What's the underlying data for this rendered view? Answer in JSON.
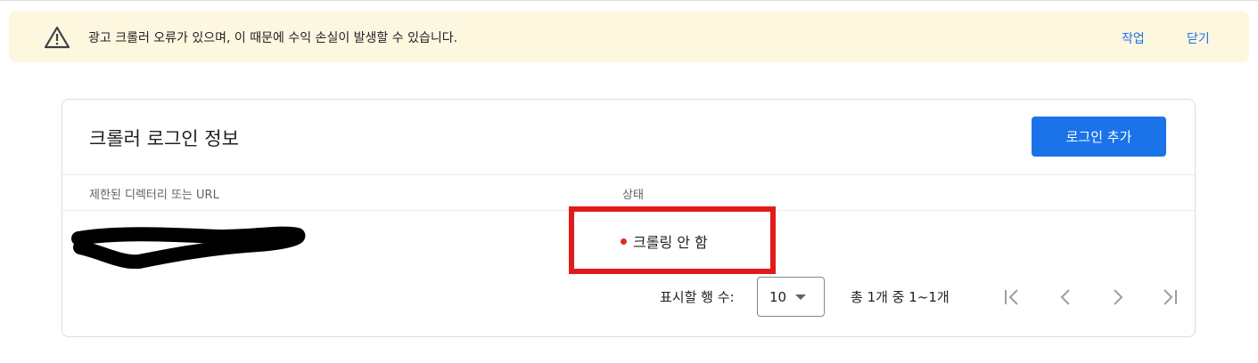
{
  "banner": {
    "icon": "warning-icon",
    "message": "광고 크롤러 오류가 있으며, 이 때문에 수익 손실이 발생할 수 있습니다.",
    "action_label": "작업",
    "close_label": "닫기",
    "background": "#fef7e0",
    "link_color": "#1a73e8"
  },
  "card": {
    "title": "크롤러 로그인 정보",
    "add_button_label": "로그인 추가",
    "columns": [
      "제한된 디렉터리 또는 URL",
      "상태"
    ],
    "rows": [
      {
        "url": "",
        "status": "크롤링 안 함",
        "status_color": "#d93025"
      }
    ]
  },
  "pagination": {
    "rows_label": "표시할 행 수:",
    "rows_value": "10",
    "range_text": "총 1개 중 1~1개",
    "icons": [
      "first-page-icon",
      "chevron-left-icon",
      "chevron-right-icon",
      "last-page-icon"
    ]
  },
  "colors": {
    "primary": "#1a73e8",
    "highlight_box": "#e01b1b"
  }
}
